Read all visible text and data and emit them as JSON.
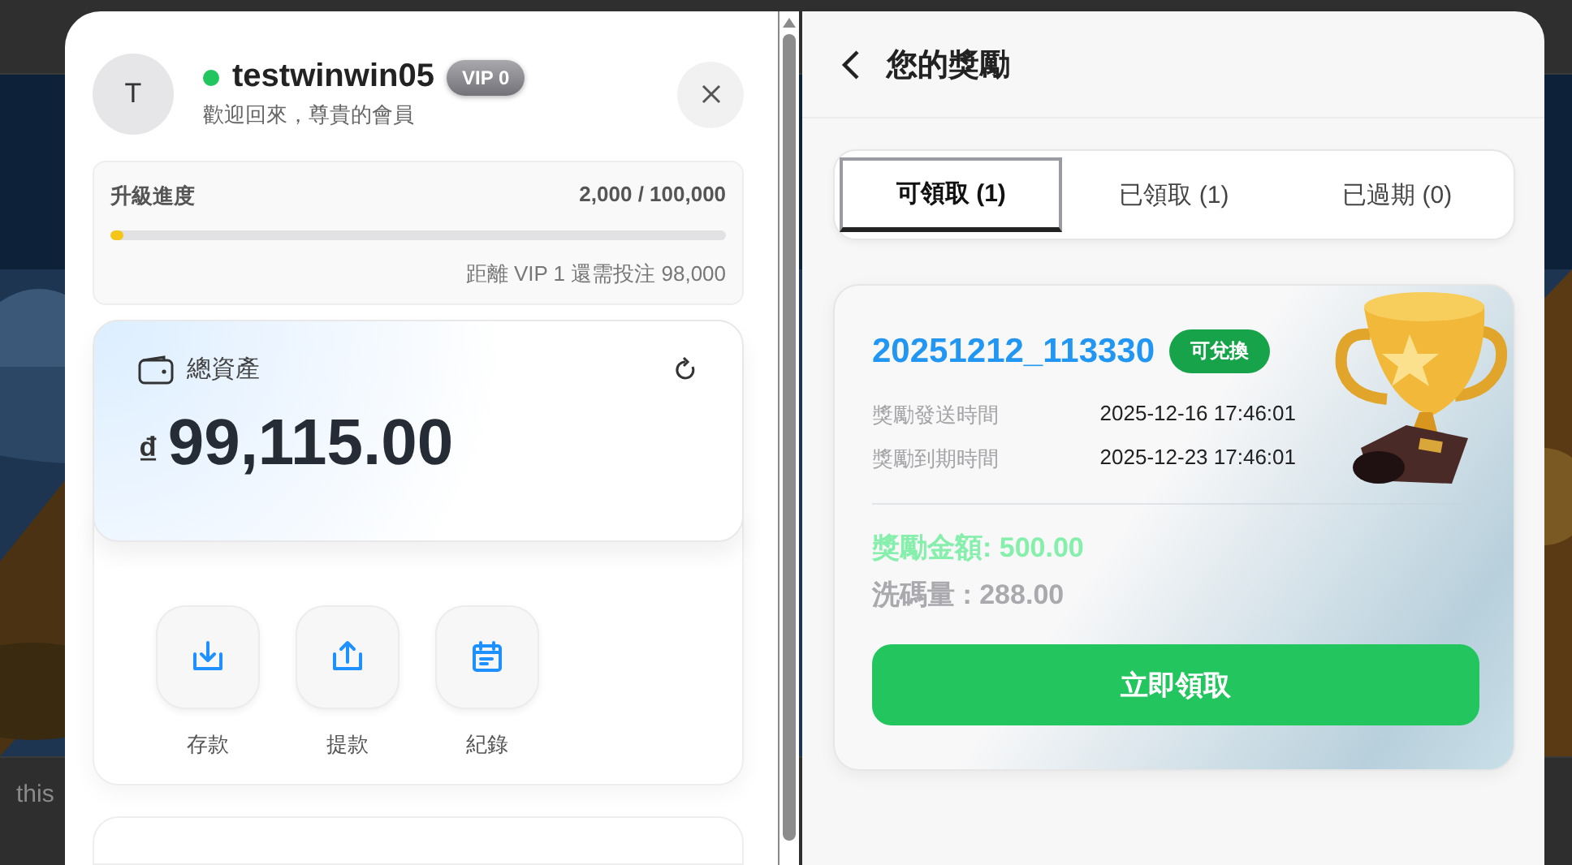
{
  "background": {
    "footer_text": "this"
  },
  "profile": {
    "avatar_initial": "T",
    "username": "testwinwin05",
    "online": true,
    "vip_badge": "VIP 0",
    "greeting": "歡迎回來，尊貴的會員"
  },
  "upgrade": {
    "title": "升級進度",
    "progress": "2,000 / 100,000",
    "level": 0.02,
    "remaining": "距離 VIP 1 還需投注 98,000"
  },
  "assets": {
    "title": "總資產",
    "currency": "₫",
    "amount": "99,115.00"
  },
  "actions": [
    {
      "kind": "deposit",
      "label": "存款"
    },
    {
      "kind": "withdraw",
      "label": "提款"
    },
    {
      "kind": "records",
      "label": "紀錄"
    }
  ],
  "rewards": {
    "title": "您的獎勵",
    "tabs": [
      {
        "label": "可領取 (1)",
        "selected": true
      },
      {
        "label": "已領取 (1)",
        "selected": false
      },
      {
        "label": "已過期 (0)",
        "selected": false
      }
    ],
    "items": [
      {
        "code": "20251212_113330",
        "status": "可兌換",
        "rows": [
          {
            "label": "獎勵發送時間",
            "value": "2025-12-16 17:46:01"
          },
          {
            "label": "獎勵到期時間",
            "value": "2025-12-23 17:46:01"
          }
        ],
        "amount": "獎勵金額: 500.00",
        "turnover": "洗碼量 : 288.00",
        "button": "立即領取"
      }
    ]
  }
}
